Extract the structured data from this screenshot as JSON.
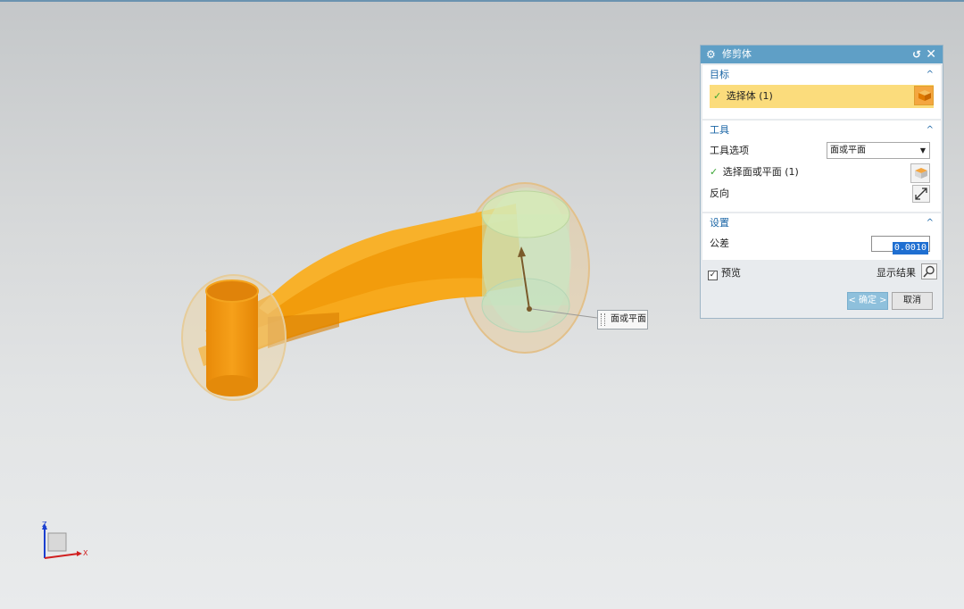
{
  "dialog": {
    "title": "修剪体",
    "groups": {
      "target": {
        "label": "目标",
        "select_body": "选择体 (1)"
      },
      "tool": {
        "label": "工具",
        "tool_option_label": "工具选项",
        "tool_option_value": "面或平面",
        "select_face": "选择面或平面 (1)",
        "reverse_label": "反向"
      },
      "settings": {
        "label": "设置",
        "tolerance_label": "公差",
        "tolerance_value": "0.0010"
      }
    },
    "preview_label": "预览",
    "show_result_label": "显示结果",
    "ok_label": "< 确定 >",
    "cancel_label": "取消"
  },
  "viewport": {
    "callout_label": "面或平面",
    "axis": {
      "z": "Z",
      "x": "X"
    }
  },
  "colors": {
    "part_orange": "#f5a013",
    "titlebar": "#5f9fc6",
    "highlight": "#fbdc7c"
  }
}
